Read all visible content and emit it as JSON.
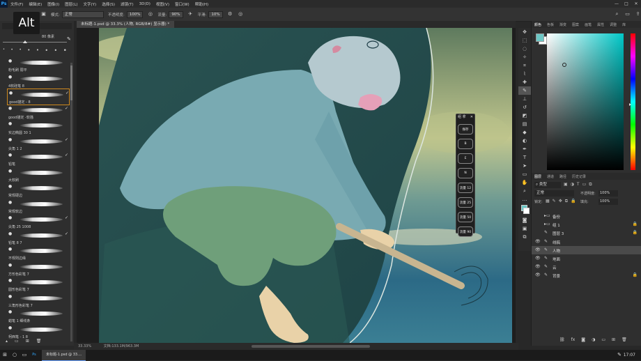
{
  "app": {
    "logo": "Ps"
  },
  "menu": [
    "文件(F)",
    "编辑(E)",
    "图像(I)",
    "图层(L)",
    "文字(Y)",
    "选择(S)",
    "滤镜(T)",
    "3D(D)",
    "视图(V)",
    "窗口(W)",
    "帮助(H)"
  ],
  "window_controls": [
    "—",
    "□",
    "✕"
  ],
  "options": {
    "mode_label": "模式:",
    "mode_value": "正常",
    "opacity_label": "不透明度:",
    "opacity_value": "100%",
    "flow_label": "流量:",
    "flow_value": "90%",
    "smooth_label": "平滑:",
    "smooth_value": "10%"
  },
  "alt_overlay": "Alt",
  "brush_panel": {
    "size_readout": "80 像素",
    "items": [
      {
        "name": "粉毛刷 弱平",
        "tick": false
      },
      {
        "name": "4软硅笔 8",
        "tick": false
      },
      {
        "name": "good描定 - 8",
        "tick": true,
        "selected": true
      },
      {
        "name": "good描定 -软描",
        "tick": true
      },
      {
        "name": "实边椭圆 30 1",
        "tick": false
      },
      {
        "name": "尖角 1 2",
        "tick": true
      },
      {
        "name": "铅笔",
        "tick": true
      },
      {
        "name": "大软刷",
        "tick": false
      },
      {
        "name": "常规硬边",
        "tick": false
      },
      {
        "name": "常规软边",
        "tick": false
      },
      {
        "name": "尖角 25 1008",
        "tick": true
      },
      {
        "name": "铅笔 8 7",
        "tick": true
      },
      {
        "name": "不规则边缘",
        "tick": false
      },
      {
        "name": "方形色彩笔 7",
        "tick": false
      },
      {
        "name": "圆形色彩笔 7",
        "tick": false
      },
      {
        "name": "三角形色彩笔 7",
        "tick": false
      },
      {
        "name": "蜡笔 1 细线条",
        "tick": false
      },
      {
        "name": "柯西笔 - 1 8",
        "tick": false
      }
    ]
  },
  "document": {
    "tab_title": "未标题-1.psd @ 33.3% (人物, RGB/8#) 显示器) *",
    "zoom": "33.33%",
    "doc_size": "文档:133.1M/963.3M"
  },
  "float_panel": {
    "title": "组 拿",
    "buttons": [
      "保存",
      "B",
      "E",
      "N",
      "流量 12",
      "流量 25",
      "流量 50",
      "流量 90"
    ]
  },
  "tools": [
    "move",
    "marquee",
    "lasso",
    "quick-select",
    "crop",
    "eyedropper",
    "heal",
    "brush",
    "stamp",
    "history-brush",
    "eraser",
    "gradient",
    "blur",
    "dodge",
    "pen",
    "type",
    "path-select",
    "rectangle",
    "hand",
    "zoom",
    "more",
    "foreground-background",
    "quick-mask",
    "screen-mode",
    "artboard"
  ],
  "color_panel": {
    "tabs": [
      "颜色",
      "色板",
      "渐变",
      "图案",
      "画笔",
      "属性",
      "调整",
      "库"
    ],
    "foreground": "#6cc7c5",
    "background": "#ffffff"
  },
  "layers_panel": {
    "tabs": [
      "图层",
      "通道",
      "路径",
      "历史记录"
    ],
    "filter_label": "类型",
    "blend_mode": "正常",
    "opacity_label": "不透明度:",
    "opacity_value": "100%",
    "lock_label": "锁定:",
    "fill_label": "填充:",
    "fill_value": "100%",
    "layers": [
      {
        "name": "备份",
        "type": "folder",
        "visible": false
      },
      {
        "name": "组 1",
        "type": "folder",
        "visible": false,
        "lock": true
      },
      {
        "name": "图层 3",
        "type": "brush",
        "visible": false,
        "lock": true
      },
      {
        "name": "线稿",
        "type": "brush",
        "visible": true
      },
      {
        "name": "人物",
        "type": "brush",
        "visible": true,
        "selected": true
      },
      {
        "name": "地面",
        "type": "brush",
        "visible": true
      },
      {
        "name": "云",
        "type": "brush",
        "visible": true
      },
      {
        "name": "背景",
        "type": "brush",
        "visible": true,
        "lock": true
      }
    ]
  },
  "taskbar": {
    "app_label": "未标题-1.psd @ 33....",
    "clock": "17:07"
  }
}
